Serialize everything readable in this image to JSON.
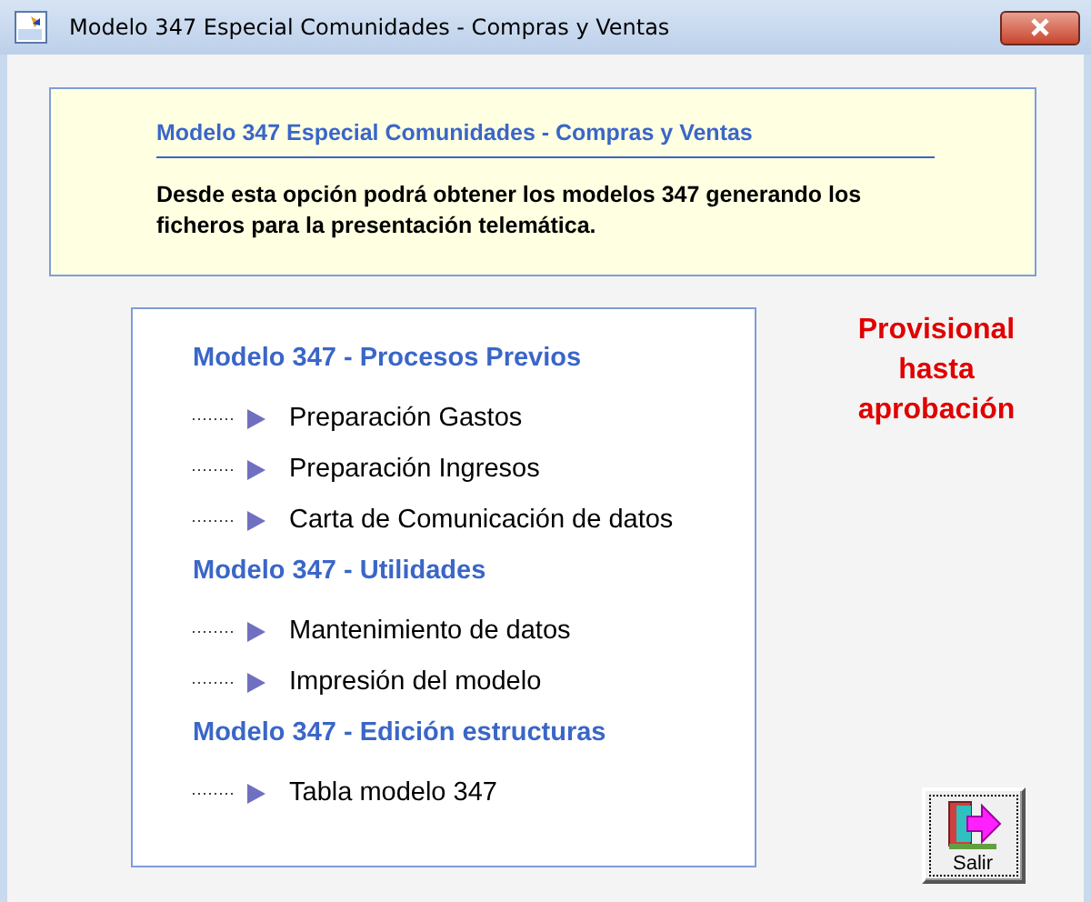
{
  "window": {
    "title": "Modelo 347 Especial Comunidades -  Compras y Ventas"
  },
  "info": {
    "title": "Modelo 347 Especial Comunidades  -  Compras y Ventas",
    "text": "Desde esta opción podrá obtener los modelos 347 generando los ficheros para la presentación telemática."
  },
  "sections": [
    {
      "title": "Modelo 347 - Procesos Previos",
      "items": [
        {
          "label": "Preparación Gastos"
        },
        {
          "label": "Preparación Ingresos"
        },
        {
          "label": "Carta de Comunicación de datos"
        }
      ]
    },
    {
      "title": "Modelo 347 - Utilidades",
      "items": [
        {
          "label": "Mantenimiento de datos"
        },
        {
          "label": "Impresión del modelo"
        }
      ]
    },
    {
      "title": "Modelo 347 - Edición estructuras",
      "items": [
        {
          "label": "Tabla modelo 347"
        }
      ]
    }
  ],
  "notice": "Provisional hasta aprobación",
  "exit_button": {
    "label": "Salir"
  }
}
